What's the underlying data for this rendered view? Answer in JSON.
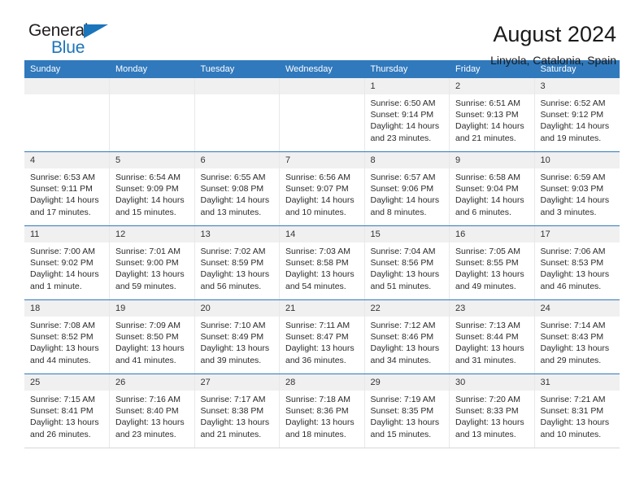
{
  "brand": {
    "name_top": "General",
    "name_bottom": "Blue",
    "triangle_icon": "triangle-logo-icon",
    "accent_color": "#1b75bb"
  },
  "header": {
    "title": "August 2024",
    "subtitle": "Linyola, Catalonia, Spain"
  },
  "calendar": {
    "header_bg": "#3079bd",
    "daynum_bg": "#f0f0f0",
    "weekdays": [
      "Sunday",
      "Monday",
      "Tuesday",
      "Wednesday",
      "Thursday",
      "Friday",
      "Saturday"
    ],
    "weeks": [
      [
        {
          "day": "",
          "empty": true
        },
        {
          "day": "",
          "empty": true
        },
        {
          "day": "",
          "empty": true
        },
        {
          "day": "",
          "empty": true
        },
        {
          "day": "1",
          "sunrise": "Sunrise: 6:50 AM",
          "sunset": "Sunset: 9:14 PM",
          "daylight1": "Daylight: 14 hours",
          "daylight2": "and 23 minutes."
        },
        {
          "day": "2",
          "sunrise": "Sunrise: 6:51 AM",
          "sunset": "Sunset: 9:13 PM",
          "daylight1": "Daylight: 14 hours",
          "daylight2": "and 21 minutes."
        },
        {
          "day": "3",
          "sunrise": "Sunrise: 6:52 AM",
          "sunset": "Sunset: 9:12 PM",
          "daylight1": "Daylight: 14 hours",
          "daylight2": "and 19 minutes."
        }
      ],
      [
        {
          "day": "4",
          "sunrise": "Sunrise: 6:53 AM",
          "sunset": "Sunset: 9:11 PM",
          "daylight1": "Daylight: 14 hours",
          "daylight2": "and 17 minutes."
        },
        {
          "day": "5",
          "sunrise": "Sunrise: 6:54 AM",
          "sunset": "Sunset: 9:09 PM",
          "daylight1": "Daylight: 14 hours",
          "daylight2": "and 15 minutes."
        },
        {
          "day": "6",
          "sunrise": "Sunrise: 6:55 AM",
          "sunset": "Sunset: 9:08 PM",
          "daylight1": "Daylight: 14 hours",
          "daylight2": "and 13 minutes."
        },
        {
          "day": "7",
          "sunrise": "Sunrise: 6:56 AM",
          "sunset": "Sunset: 9:07 PM",
          "daylight1": "Daylight: 14 hours",
          "daylight2": "and 10 minutes."
        },
        {
          "day": "8",
          "sunrise": "Sunrise: 6:57 AM",
          "sunset": "Sunset: 9:06 PM",
          "daylight1": "Daylight: 14 hours",
          "daylight2": "and 8 minutes."
        },
        {
          "day": "9",
          "sunrise": "Sunrise: 6:58 AM",
          "sunset": "Sunset: 9:04 PM",
          "daylight1": "Daylight: 14 hours",
          "daylight2": "and 6 minutes."
        },
        {
          "day": "10",
          "sunrise": "Sunrise: 6:59 AM",
          "sunset": "Sunset: 9:03 PM",
          "daylight1": "Daylight: 14 hours",
          "daylight2": "and 3 minutes."
        }
      ],
      [
        {
          "day": "11",
          "sunrise": "Sunrise: 7:00 AM",
          "sunset": "Sunset: 9:02 PM",
          "daylight1": "Daylight: 14 hours",
          "daylight2": "and 1 minute."
        },
        {
          "day": "12",
          "sunrise": "Sunrise: 7:01 AM",
          "sunset": "Sunset: 9:00 PM",
          "daylight1": "Daylight: 13 hours",
          "daylight2": "and 59 minutes."
        },
        {
          "day": "13",
          "sunrise": "Sunrise: 7:02 AM",
          "sunset": "Sunset: 8:59 PM",
          "daylight1": "Daylight: 13 hours",
          "daylight2": "and 56 minutes."
        },
        {
          "day": "14",
          "sunrise": "Sunrise: 7:03 AM",
          "sunset": "Sunset: 8:58 PM",
          "daylight1": "Daylight: 13 hours",
          "daylight2": "and 54 minutes."
        },
        {
          "day": "15",
          "sunrise": "Sunrise: 7:04 AM",
          "sunset": "Sunset: 8:56 PM",
          "daylight1": "Daylight: 13 hours",
          "daylight2": "and 51 minutes."
        },
        {
          "day": "16",
          "sunrise": "Sunrise: 7:05 AM",
          "sunset": "Sunset: 8:55 PM",
          "daylight1": "Daylight: 13 hours",
          "daylight2": "and 49 minutes."
        },
        {
          "day": "17",
          "sunrise": "Sunrise: 7:06 AM",
          "sunset": "Sunset: 8:53 PM",
          "daylight1": "Daylight: 13 hours",
          "daylight2": "and 46 minutes."
        }
      ],
      [
        {
          "day": "18",
          "sunrise": "Sunrise: 7:08 AM",
          "sunset": "Sunset: 8:52 PM",
          "daylight1": "Daylight: 13 hours",
          "daylight2": "and 44 minutes."
        },
        {
          "day": "19",
          "sunrise": "Sunrise: 7:09 AM",
          "sunset": "Sunset: 8:50 PM",
          "daylight1": "Daylight: 13 hours",
          "daylight2": "and 41 minutes."
        },
        {
          "day": "20",
          "sunrise": "Sunrise: 7:10 AM",
          "sunset": "Sunset: 8:49 PM",
          "daylight1": "Daylight: 13 hours",
          "daylight2": "and 39 minutes."
        },
        {
          "day": "21",
          "sunrise": "Sunrise: 7:11 AM",
          "sunset": "Sunset: 8:47 PM",
          "daylight1": "Daylight: 13 hours",
          "daylight2": "and 36 minutes."
        },
        {
          "day": "22",
          "sunrise": "Sunrise: 7:12 AM",
          "sunset": "Sunset: 8:46 PM",
          "daylight1": "Daylight: 13 hours",
          "daylight2": "and 34 minutes."
        },
        {
          "day": "23",
          "sunrise": "Sunrise: 7:13 AM",
          "sunset": "Sunset: 8:44 PM",
          "daylight1": "Daylight: 13 hours",
          "daylight2": "and 31 minutes."
        },
        {
          "day": "24",
          "sunrise": "Sunrise: 7:14 AM",
          "sunset": "Sunset: 8:43 PM",
          "daylight1": "Daylight: 13 hours",
          "daylight2": "and 29 minutes."
        }
      ],
      [
        {
          "day": "25",
          "sunrise": "Sunrise: 7:15 AM",
          "sunset": "Sunset: 8:41 PM",
          "daylight1": "Daylight: 13 hours",
          "daylight2": "and 26 minutes."
        },
        {
          "day": "26",
          "sunrise": "Sunrise: 7:16 AM",
          "sunset": "Sunset: 8:40 PM",
          "daylight1": "Daylight: 13 hours",
          "daylight2": "and 23 minutes."
        },
        {
          "day": "27",
          "sunrise": "Sunrise: 7:17 AM",
          "sunset": "Sunset: 8:38 PM",
          "daylight1": "Daylight: 13 hours",
          "daylight2": "and 21 minutes."
        },
        {
          "day": "28",
          "sunrise": "Sunrise: 7:18 AM",
          "sunset": "Sunset: 8:36 PM",
          "daylight1": "Daylight: 13 hours",
          "daylight2": "and 18 minutes."
        },
        {
          "day": "29",
          "sunrise": "Sunrise: 7:19 AM",
          "sunset": "Sunset: 8:35 PM",
          "daylight1": "Daylight: 13 hours",
          "daylight2": "and 15 minutes."
        },
        {
          "day": "30",
          "sunrise": "Sunrise: 7:20 AM",
          "sunset": "Sunset: 8:33 PM",
          "daylight1": "Daylight: 13 hours",
          "daylight2": "and 13 minutes."
        },
        {
          "day": "31",
          "sunrise": "Sunrise: 7:21 AM",
          "sunset": "Sunset: 8:31 PM",
          "daylight1": "Daylight: 13 hours",
          "daylight2": "and 10 minutes."
        }
      ]
    ]
  }
}
